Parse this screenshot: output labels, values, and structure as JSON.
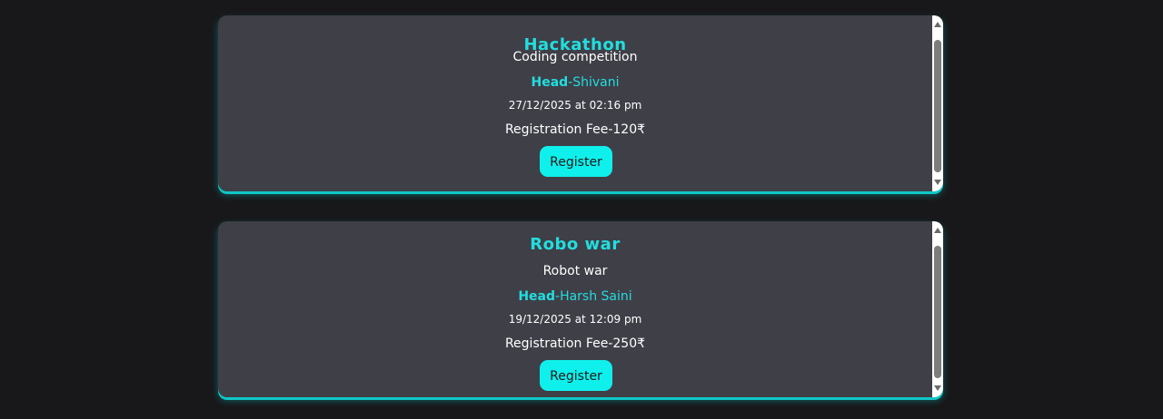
{
  "events": [
    {
      "title": "Hackathon",
      "description": "Coding competition",
      "head_label": "Head",
      "head_name": "-Shivani",
      "datetime": "27/12/2025 at 02:16 pm",
      "fee": "Registration Fee-120₹",
      "button_label": "Register"
    },
    {
      "title": "Robo war",
      "description": "Robot war",
      "head_label": "Head",
      "head_name": "-Harsh Saini",
      "datetime": "19/12/2025 at 12:09 pm",
      "fee": "Registration Fee-250₹",
      "button_label": "Register"
    }
  ],
  "colors": {
    "background": "#18181a",
    "card": "#3f3f48",
    "accent": "#22dede",
    "button": "#0ff0ec"
  },
  "icons": {
    "scroll_up": "scroll-up-arrow-icon",
    "scroll_down": "scroll-down-arrow-icon"
  }
}
